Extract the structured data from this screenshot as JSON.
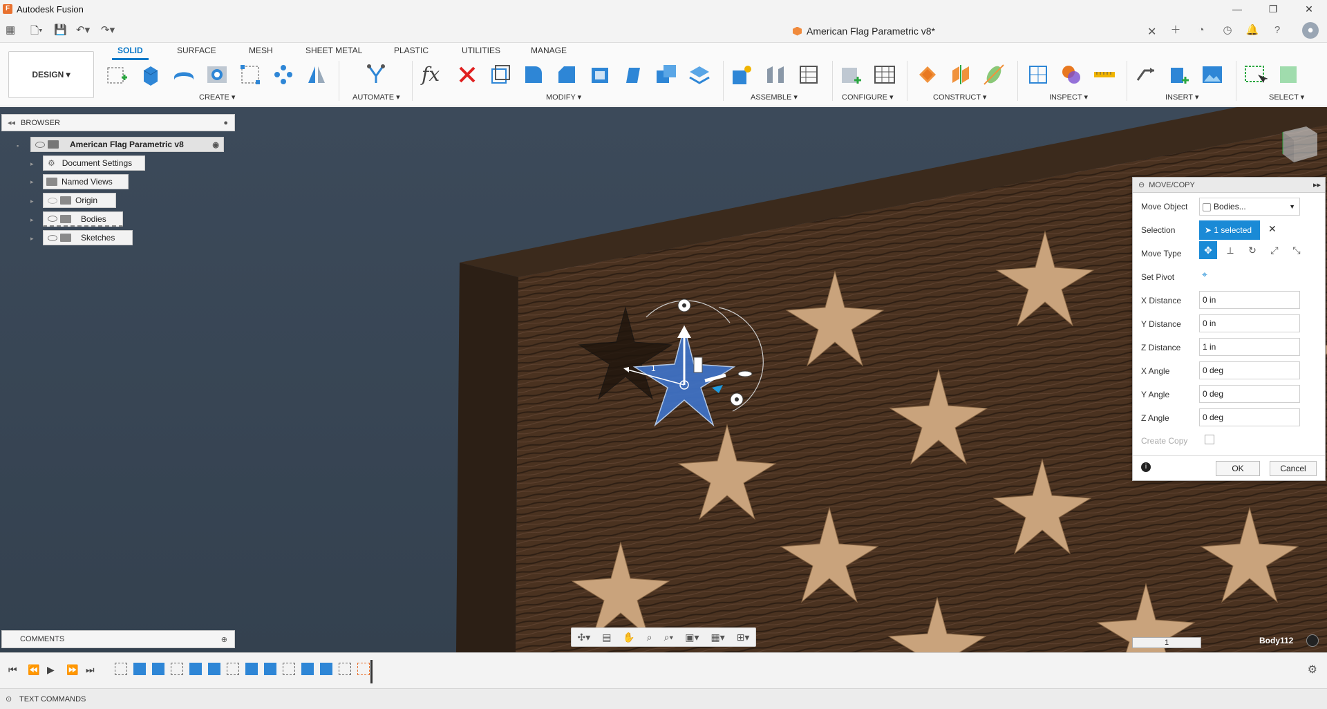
{
  "app": {
    "title": "Autodesk Fusion",
    "logo_letter": "F"
  },
  "window_controls": [
    "—",
    "❐",
    "✕"
  ],
  "document": {
    "title": "American Flag Parametric v8*"
  },
  "design_button": "DESIGN ▾",
  "ribbon": {
    "tabs": [
      "SOLID",
      "SURFACE",
      "MESH",
      "SHEET METAL",
      "PLASTIC",
      "UTILITIES",
      "MANAGE"
    ],
    "active_tab": "SOLID",
    "groups": [
      "CREATE ▾",
      "AUTOMATE ▾",
      "MODIFY ▾",
      "ASSEMBLE ▾",
      "CONFIGURE ▾",
      "CONSTRUCT ▾",
      "INSPECT ▾",
      "INSERT ▾",
      "SELECT ▾"
    ],
    "fx_label": "fx"
  },
  "browser": {
    "title": "BROWSER",
    "root": "American Flag Parametric v8",
    "items": [
      "Document Settings",
      "Named Views",
      "Origin",
      "Bodies",
      "Sketches"
    ]
  },
  "comments": {
    "title": "COMMENTS"
  },
  "text_commands": "TEXT COMMANDS",
  "dialog": {
    "title": "MOVE/COPY",
    "move_object_label": "Move Object",
    "move_object_value": "Bodies...",
    "selection_label": "Selection",
    "selection_value": "1 selected",
    "move_type_label": "Move Type",
    "set_pivot_label": "Set Pivot",
    "fields": [
      {
        "label": "X Distance",
        "value": "0 in"
      },
      {
        "label": "Y Distance",
        "value": "0 in"
      },
      {
        "label": "Z Distance",
        "value": "1 in"
      },
      {
        "label": "X Angle",
        "value": "0 deg"
      },
      {
        "label": "Y Angle",
        "value": "0 deg"
      },
      {
        "label": "Z Angle",
        "value": "0 deg"
      }
    ],
    "create_copy_label": "Create Copy",
    "ok": "OK",
    "cancel": "Cancel"
  },
  "viewport": {
    "body_label": "Body112",
    "manipulator_value": "1",
    "ruler_value": "1"
  },
  "colors": {
    "accent": "#0a78c8",
    "selection": "#2f8fd8",
    "wood_dark": "#4a3220",
    "star_wood": "#c9a37c"
  }
}
